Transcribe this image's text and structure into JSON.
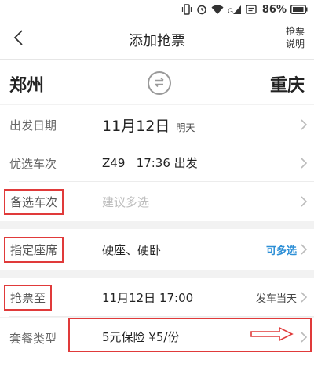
{
  "status_bar": {
    "battery": "86%"
  },
  "nav": {
    "title": "添加抢票",
    "rules_line1": "抢票",
    "rules_line2": "说明"
  },
  "route": {
    "from": "郑州",
    "to": "重庆"
  },
  "rows": {
    "date": {
      "label": "出发日期",
      "value": "11月12日",
      "extra": "明天"
    },
    "preferred_train": {
      "label": "优选车次",
      "value": "Z49   17:36 出发"
    },
    "backup_train": {
      "label": "备选车次",
      "placeholder": "建议多选"
    },
    "seat": {
      "label": "指定座席",
      "value": "硬座、硬卧",
      "right": "可多选"
    },
    "deadline": {
      "label": "抢票至",
      "value": "11月12日 17:00",
      "right": "发车当天"
    },
    "package": {
      "label": "套餐类型",
      "value": "5元保险 ¥5/份"
    }
  },
  "colors": {
    "highlight_red": "#e03a3a",
    "accent_blue": "#2d8fd6"
  },
  "icons": [
    "vibrate-icon",
    "alarm-icon",
    "wifi-icon",
    "signal-icon",
    "notification-icon",
    "battery-icon",
    "back-arrow-icon",
    "swap-icon",
    "chevron-right-icon",
    "hint-arrow-icon"
  ]
}
